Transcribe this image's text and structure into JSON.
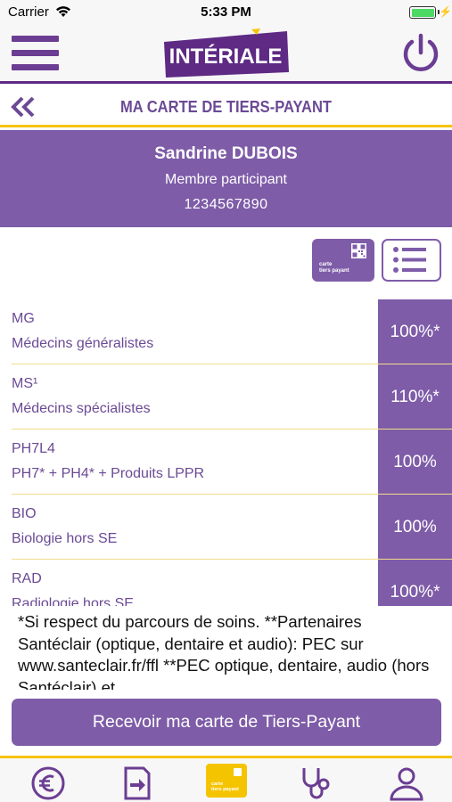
{
  "status_bar": {
    "carrier": "Carrier",
    "time": "5:33 PM",
    "battery_level": 1.0,
    "battery_color": "#4cd964"
  },
  "header": {
    "logo_text": "INTÉRIALE",
    "menu_icon": "hamburger-menu-icon",
    "power_icon": "power-icon"
  },
  "titlebar": {
    "title": "MA CARTE DE TIERS-PAYANT",
    "back_icon": "double-chevron-left-icon"
  },
  "member": {
    "name": "Sandrine DUBOIS",
    "role": "Membre participant",
    "number": "1234567890"
  },
  "view_toggle": {
    "card_label_line1": "carte",
    "card_label_line2": "tiers payant"
  },
  "coverage": [
    {
      "code": "MG",
      "label": "Médecins généralistes",
      "value": "100%*"
    },
    {
      "code": "MS¹",
      "label": "Médecins spécialistes",
      "value": "110%*"
    },
    {
      "code": "PH7L4",
      "label": "PH7* + PH4* + Produits LPPR",
      "value": "100%"
    },
    {
      "code": "BIO",
      "label": "Biologie hors SE",
      "value": "100%"
    },
    {
      "code": "RAD",
      "label": "Radiologie hors SE",
      "value": "100%*"
    }
  ],
  "footnote": "*Si respect du parcours de soins. **Partenaires Santéclair (optique, dentaire et audio): PEC sur www.santeclair.fr/ffl **PEC optique, dentaire, audio (hors Santéclair) et",
  "primary_button": "Recevoir ma carte de Tiers-Payant",
  "tabbar": {
    "active_tab": "card",
    "card_label_line1": "carte",
    "card_label_line2": "tiers payant",
    "icons": [
      "euro-icon",
      "document-arrow-icon",
      "card-icon",
      "stethoscope-icon",
      "user-icon"
    ]
  },
  "colors": {
    "brand_purple": "#7e5ca8",
    "dark_purple": "#5e2a84",
    "accent_yellow": "#f5c400"
  }
}
